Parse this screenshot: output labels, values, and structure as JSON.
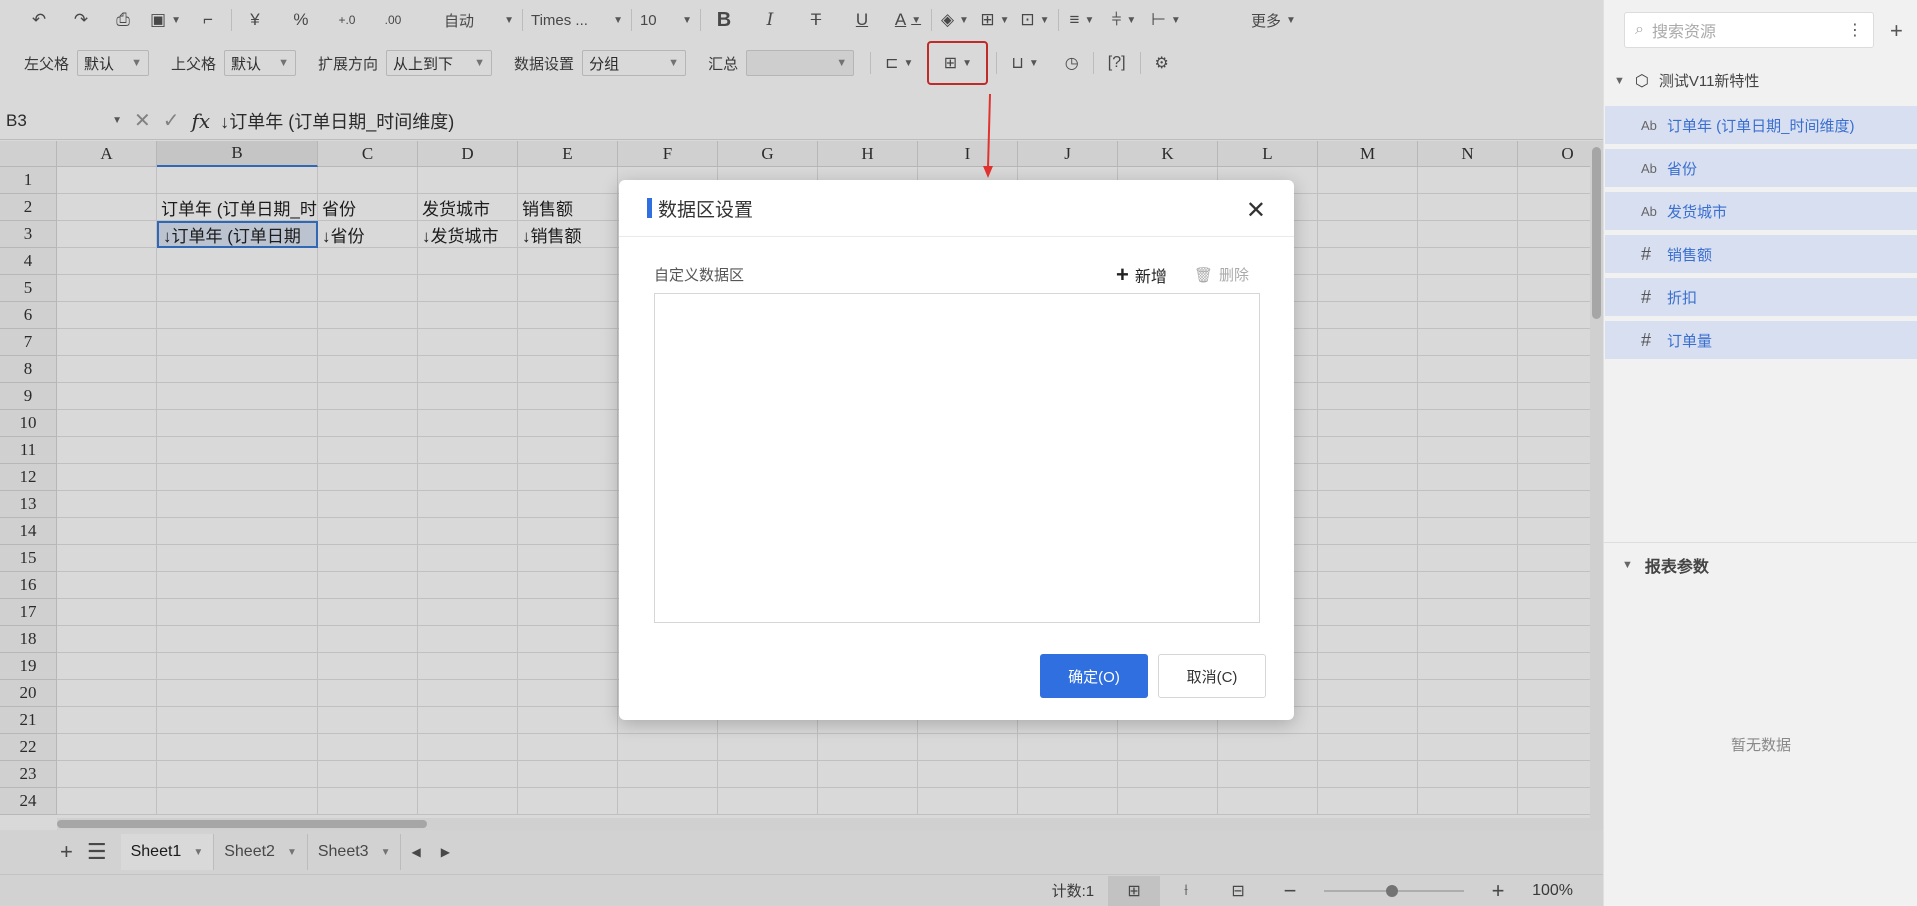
{
  "toolbar1": {
    "auto_label": "自动",
    "font_name": "Times ...",
    "font_size": "10",
    "more_label": "更多"
  },
  "toolbar2": {
    "left_parent_label": "左父格",
    "left_parent_value": "默认",
    "top_parent_label": "上父格",
    "top_parent_value": "默认",
    "expand_dir_label": "扩展方向",
    "expand_dir_value": "从上到下",
    "data_setting_label": "数据设置",
    "data_setting_value": "分组",
    "summary_label": "汇总",
    "summary_value": ""
  },
  "formula_bar": {
    "cell_ref": "B3",
    "fx": "fx",
    "formula": "↓订单年 (订单日期_时间维度)"
  },
  "grid": {
    "columns": [
      "A",
      "B",
      "C",
      "D",
      "E",
      "F",
      "G",
      "H",
      "I",
      "J",
      "K",
      "L",
      "M",
      "N",
      "O"
    ],
    "rows": [
      "1",
      "2",
      "3",
      "4",
      "5",
      "6",
      "7",
      "8",
      "9",
      "10",
      "11",
      "12",
      "13",
      "14",
      "15",
      "16",
      "17",
      "18",
      "19",
      "20",
      "21",
      "22",
      "23",
      "24"
    ],
    "selected_column": "B",
    "cells": {
      "B2": "订单年 (订单日期_时",
      "C2": "省份",
      "D2": "发货城市",
      "E2": "销售额",
      "B3": "↓订单年 (订单日期",
      "C3": "↓省份",
      "D3": "↓发货城市",
      "E3": "↓销售额"
    }
  },
  "sheets": {
    "tabs": [
      "Sheet1",
      "Sheet2",
      "Sheet3"
    ],
    "active": "Sheet1"
  },
  "status": {
    "count": "计数:1",
    "zoom": "100%"
  },
  "right_panel": {
    "search_placeholder": "搜索资源",
    "dataset_name": "测试V11新特性",
    "fields": [
      {
        "type": "Ab",
        "name": "订单年 (订单日期_时间维度)"
      },
      {
        "type": "Ab",
        "name": "省份"
      },
      {
        "type": "Ab",
        "name": "发货城市"
      },
      {
        "type": "#",
        "name": "销售额"
      },
      {
        "type": "#",
        "name": "折扣"
      },
      {
        "type": "#",
        "name": "订单量"
      }
    ],
    "params_title": "报表参数",
    "params_empty": "暂无数据"
  },
  "dialog": {
    "title": "数据区设置",
    "subtitle": "自定义数据区",
    "add_label": "新增",
    "delete_label": "删除",
    "ok_label": "确定(O)",
    "cancel_label": "取消(C)"
  },
  "colors": {
    "primary": "#2f6fdf",
    "highlight": "#e0332f",
    "field_bg": "#d8dff0",
    "field_text": "#3a6fd0"
  }
}
